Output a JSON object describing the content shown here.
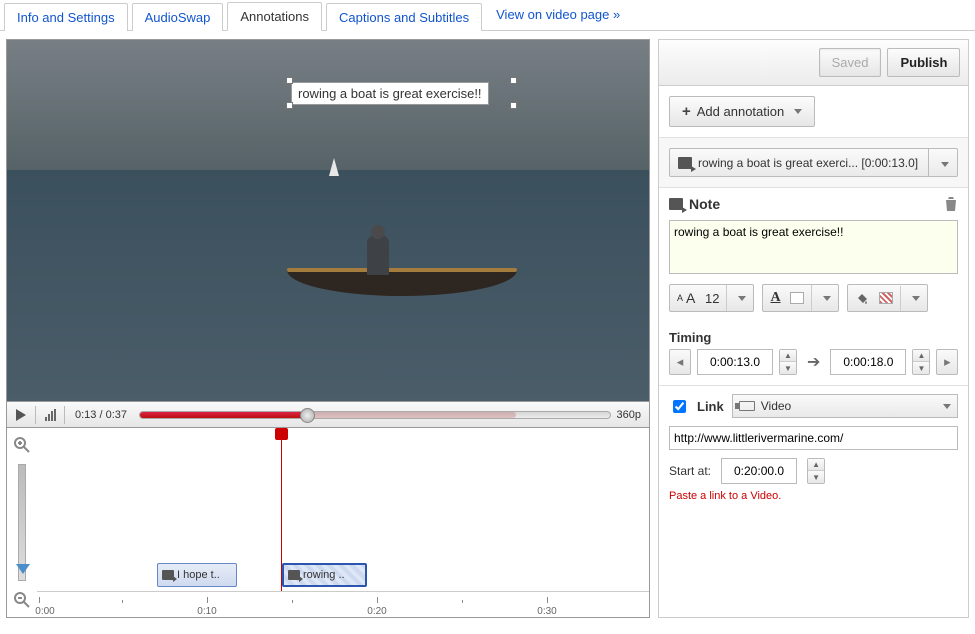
{
  "tabs": {
    "info": "Info and Settings",
    "audioswap": "AudioSwap",
    "annotations": "Annotations",
    "captions": "Captions and Subtitles",
    "viewlink": "View on video page »"
  },
  "overlay_text": "rowing a boat is great exercise!!",
  "controls": {
    "time": "0:13 / 0:37",
    "quality": "360p"
  },
  "timeline": {
    "clip1_label": "I hope t..",
    "clip2_label": "rowing ..",
    "ticks": [
      "0:00",
      "0:10",
      "0:20",
      "0:30"
    ]
  },
  "buttons": {
    "saved": "Saved",
    "publish": "Publish",
    "add_annotation": "Add annotation"
  },
  "selector_text": "rowing a boat is great exerci... [0:00:13.0]",
  "note": {
    "heading": "Note",
    "text": "rowing a boat is great exercise!!",
    "font_size": "12"
  },
  "timing": {
    "heading": "Timing",
    "start": "0:00:13.0",
    "end": "0:00:18.0"
  },
  "link": {
    "label": "Link",
    "type": "Video",
    "url": "http://www.littlerivermarine.com/",
    "start_at_label": "Start at:",
    "start_at": "0:20:00.0",
    "hint": "Paste a link to a Video."
  }
}
